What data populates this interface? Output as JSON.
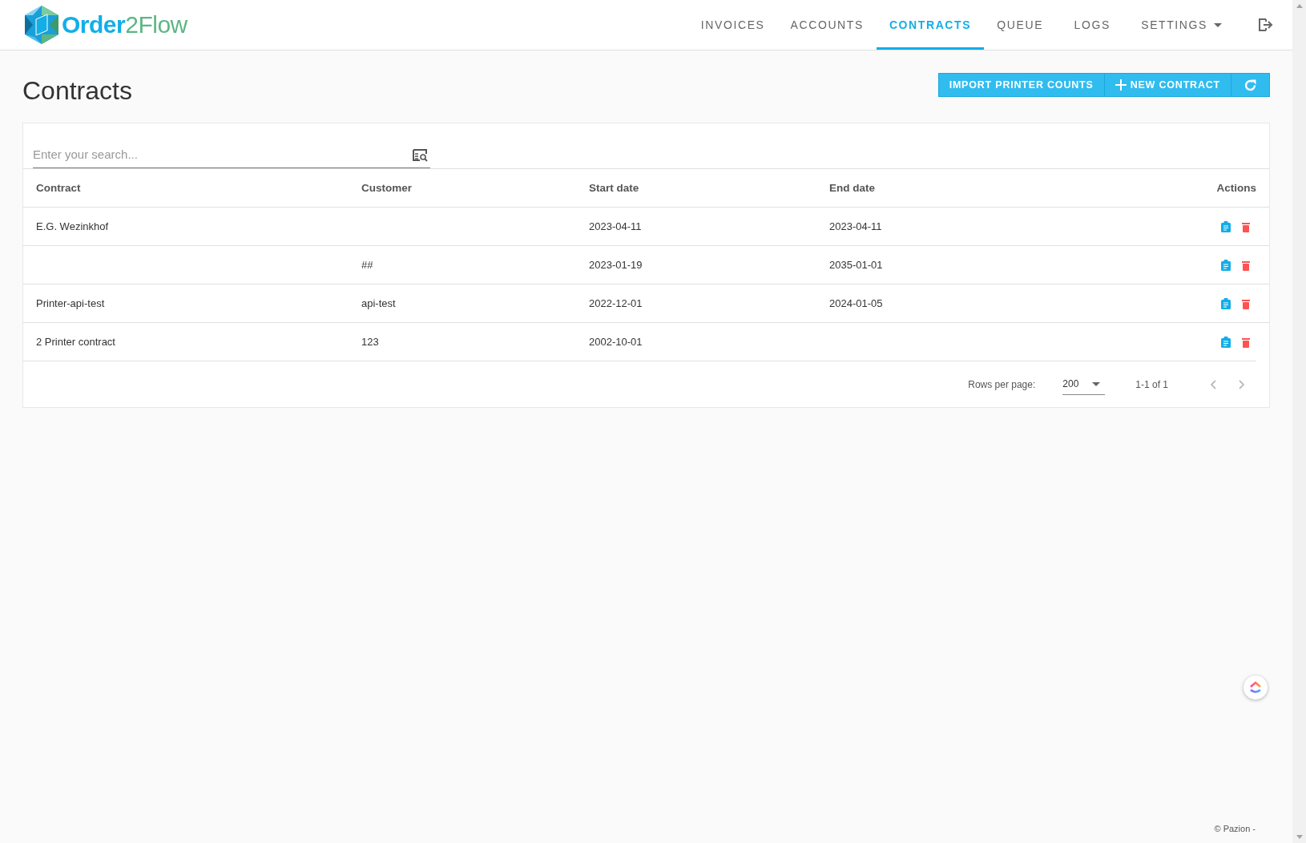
{
  "brand": {
    "first": "Order",
    "second": "2Flow"
  },
  "nav": [
    {
      "label": "INVOICES",
      "selected": false
    },
    {
      "label": "ACCOUNTS",
      "selected": false
    },
    {
      "label": "CONTRACTS",
      "selected": true
    },
    {
      "label": "QUEUE",
      "selected": false
    },
    {
      "label": "LOGS",
      "selected": false
    },
    {
      "label": "SETTINGS",
      "selected": false,
      "dropdown": true
    }
  ],
  "page_title": "Contracts",
  "toolbar": {
    "import_button": "IMPORT PRINTER COUNTS",
    "new_button": "NEW CONTRACT"
  },
  "search": {
    "placeholder": "Enter your search..."
  },
  "table": {
    "columns": [
      "Contract",
      "Customer",
      "Start date",
      "End date",
      "Actions"
    ],
    "rows": [
      {
        "contract": "E.G. Wezinkhof",
        "customer": "",
        "start": "2023-04-11",
        "end": "2023-04-11"
      },
      {
        "contract": "",
        "customer": "##",
        "start": "2023-01-19",
        "end": "2035-01-01"
      },
      {
        "contract": "Printer-api-test",
        "customer": "api-test",
        "start": "2022-12-01",
        "end": "2024-01-05"
      },
      {
        "contract": "2 Printer contract",
        "customer": "123",
        "start": "2002-10-01",
        "end": ""
      }
    ]
  },
  "pagination": {
    "rows_per_page_label": "Rows per page:",
    "rows_per_page": "200",
    "range": "1-1 of 1"
  },
  "footer": "© Pazion -"
}
